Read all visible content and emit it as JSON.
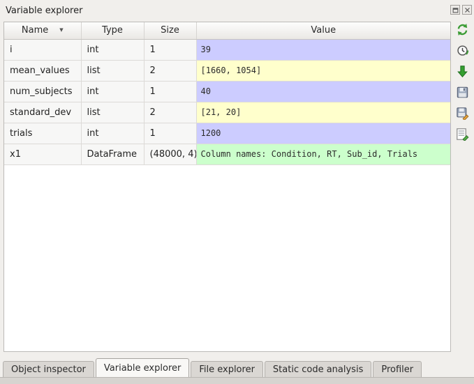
{
  "panel": {
    "title": "Variable explorer"
  },
  "dock_icons": [
    "float-icon",
    "close-icon"
  ],
  "table": {
    "headers": {
      "name": "Name",
      "type": "Type",
      "size": "Size",
      "value": "Value",
      "sort_indicator": "▼"
    },
    "rows": [
      {
        "name": "i",
        "type": "int",
        "size": "1",
        "value": "39",
        "value_bg": "#ccccff"
      },
      {
        "name": "mean_values",
        "type": "list",
        "size": "2",
        "value": "[1660, 1054]",
        "value_bg": "#ffffcc"
      },
      {
        "name": "num_subjects",
        "type": "int",
        "size": "1",
        "value": "40",
        "value_bg": "#ccccff"
      },
      {
        "name": "standard_dev",
        "type": "list",
        "size": "2",
        "value": "[21, 20]",
        "value_bg": "#ffffcc"
      },
      {
        "name": "trials",
        "type": "int",
        "size": "1",
        "value": "1200",
        "value_bg": "#ccccff"
      },
      {
        "name": "x1",
        "type": "DataFrame",
        "size": "(48000, 4)",
        "value": "Column names: Condition, RT, Sub_id, Trials",
        "value_bg": "#ccffcc"
      }
    ]
  },
  "toolbar": {
    "icons": [
      "refresh-icon",
      "auto-refresh-icon",
      "import-data-icon",
      "save-data-icon",
      "save-data-as-icon",
      "options-icon"
    ]
  },
  "tabs": [
    {
      "label": "Object inspector",
      "active": false
    },
    {
      "label": "Variable explorer",
      "active": true
    },
    {
      "label": "File explorer",
      "active": false
    },
    {
      "label": "Static code analysis",
      "active": false
    },
    {
      "label": "Profiler",
      "active": false
    }
  ],
  "colors": {
    "int_bg": "#ccccff",
    "list_bg": "#ffffcc",
    "dataframe_bg": "#ccffcc"
  }
}
